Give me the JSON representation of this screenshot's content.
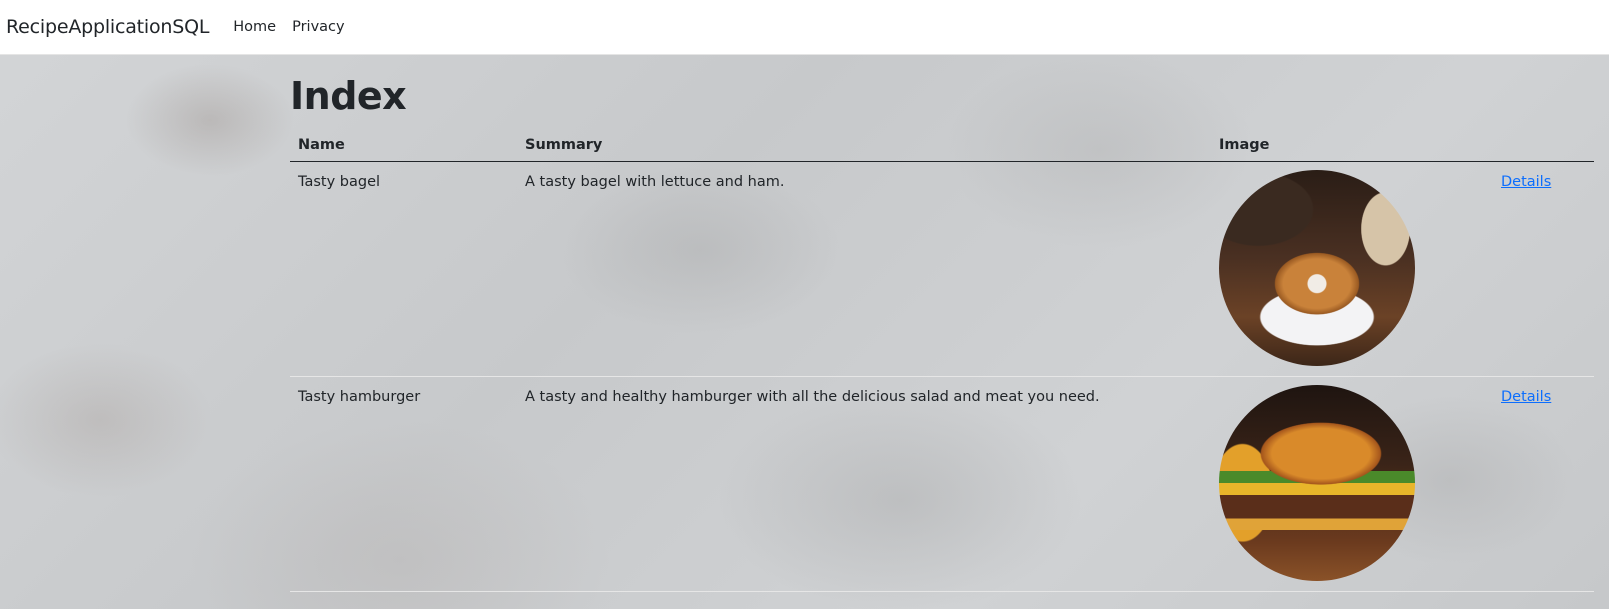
{
  "navbar": {
    "brand": "RecipeApplicationSQL",
    "links": [
      "Home",
      "Privacy"
    ]
  },
  "page": {
    "title": "Index"
  },
  "table": {
    "headers": {
      "name": "Name",
      "summary": "Summary",
      "image": "Image"
    },
    "rows": [
      {
        "name": "Tasty bagel",
        "summary": "A tasty bagel with lettuce and ham.",
        "image": "bagel-photo",
        "details": "Details"
      },
      {
        "name": "Tasty hamburger",
        "summary": "A tasty and healthy hamburger with all the delicious salad and meat you need.",
        "image": "hamburger-photo",
        "details": "Details"
      }
    ]
  },
  "colors": {
    "link": "#0d6efd",
    "text": "#212529",
    "navbar_bg": "#ffffff"
  }
}
